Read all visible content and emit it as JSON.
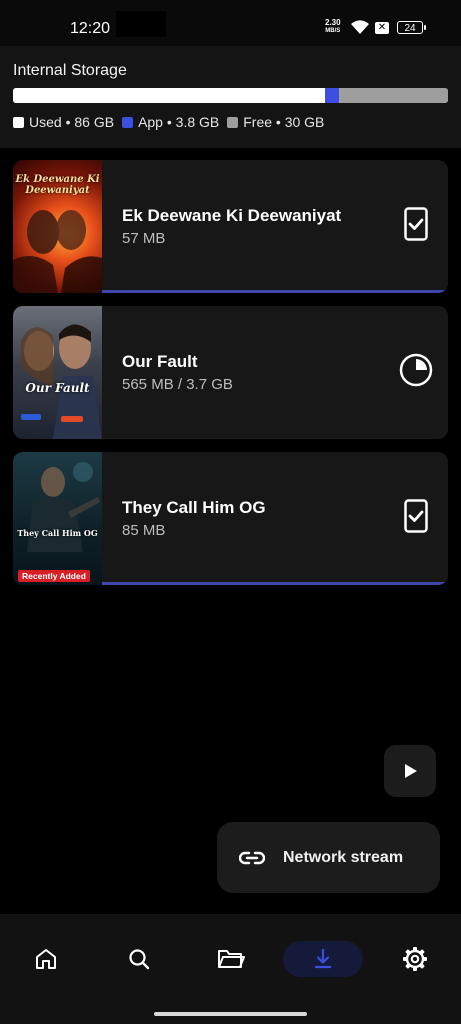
{
  "status_bar": {
    "time": "12:20",
    "net_speed_value": "2.30",
    "net_speed_unit": "MB/S",
    "battery": "24"
  },
  "storage": {
    "title": "Internal Storage",
    "used_label": "Used • 86 GB",
    "app_label": "App • 3.8 GB",
    "free_label": "Free • 30 GB",
    "used_gb": 86,
    "app_gb": 3.8,
    "free_gb": 30,
    "colors": {
      "used": "#ffffff",
      "app": "#3c4fe0",
      "free": "#9e9e9e"
    }
  },
  "downloads": [
    {
      "title": "Ek Deewane Ki Deewaniyat",
      "size": "57 MB",
      "poster_text": "Ek Deewane Ki Deewaniyat",
      "status_icon": "downloaded-phone-check-icon",
      "progress": 1.0,
      "badge": ""
    },
    {
      "title": "Our Fault",
      "size": "565 MB / 3.7 GB",
      "poster_text": "Our Fault",
      "status_icon": "download-progress-pie-icon",
      "progress": 0.15,
      "badge": ""
    },
    {
      "title": "They Call Him OG",
      "size": "85 MB",
      "poster_text": "They Call Him OG",
      "status_icon": "downloaded-phone-check-icon",
      "progress": 1.0,
      "badge": "Recently Added"
    }
  ],
  "fab": {
    "play_icon": "play-icon",
    "network_stream_label": "Network stream",
    "network_stream_icon": "link-icon"
  },
  "bottom_nav": {
    "items": [
      "home-icon",
      "search-icon",
      "folder-icon",
      "download-icon",
      "settings-icon"
    ],
    "active": "download-icon",
    "accent": "#3c4fe0"
  }
}
